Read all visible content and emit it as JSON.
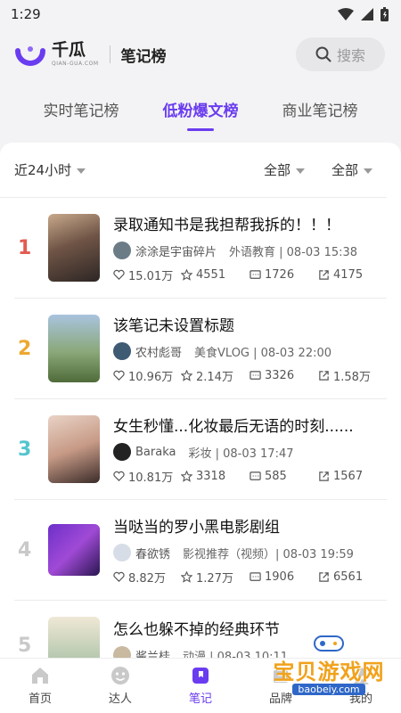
{
  "status": {
    "time": "1:29"
  },
  "header": {
    "logo_cn": "千瓜",
    "logo_en": "QIAN-GUA.COM",
    "title": "笔记榜",
    "search_label": "搜索"
  },
  "tabs": [
    {
      "label": "实时笔记榜",
      "active": false
    },
    {
      "label": "低粉爆文榜",
      "active": true
    },
    {
      "label": "商业笔记榜",
      "active": false
    }
  ],
  "filters": {
    "time": "近24小时",
    "filter_a": "全部",
    "filter_b": "全部"
  },
  "items": [
    {
      "rank": "1",
      "rank_color": "#e35a52",
      "title": "录取通知书是我担帮我拆的！！！",
      "author": "涂涂是宇宙碎片",
      "meta": "外语教育 | 08-03 15:38",
      "likes": "15.01万",
      "favs": "4551",
      "comments": "1726",
      "shares": "4175"
    },
    {
      "rank": "2",
      "rank_color": "#eda832",
      "title": "该笔记未设置标题",
      "author": "农村彪哥",
      "meta": "美食VLOG | 08-03 22:00",
      "likes": "10.96万",
      "favs": "2.14万",
      "comments": "3326",
      "shares": "1.58万"
    },
    {
      "rank": "3",
      "rank_color": "#55c5cf",
      "title": "女生秒懂...化妆最后无语的时刻......",
      "author": "Baraka",
      "meta": "彩妆 | 08-03 17:47",
      "likes": "10.81万",
      "favs": "3318",
      "comments": "585",
      "shares": "1567"
    },
    {
      "rank": "4",
      "rank_color": "#c9c9c9",
      "title": "当哒当的罗小黑电影剧组",
      "author": "春欲锈",
      "meta": "影视推荐（视频）| 08-03 19:59",
      "likes": "8.82万",
      "favs": "1.27万",
      "comments": "1906",
      "shares": "6561"
    },
    {
      "rank": "5",
      "rank_color": "#c9c9c9",
      "title": "怎么也躲不掉的经典环节",
      "author": "酱兰桂",
      "meta": "动漫 | 08-03 10:11",
      "likes": "",
      "favs": "",
      "comments": "",
      "shares": ""
    }
  ],
  "nav": [
    {
      "label": "首页",
      "active": false
    },
    {
      "label": "达人",
      "active": false
    },
    {
      "label": "笔记",
      "active": true
    },
    {
      "label": "品牌",
      "active": false
    },
    {
      "label": "我的",
      "active": false
    }
  ],
  "watermark": {
    "text": "宝贝游戏网",
    "url": "baobeiy.com"
  },
  "colors": {
    "accent": "#6a3cf0"
  }
}
